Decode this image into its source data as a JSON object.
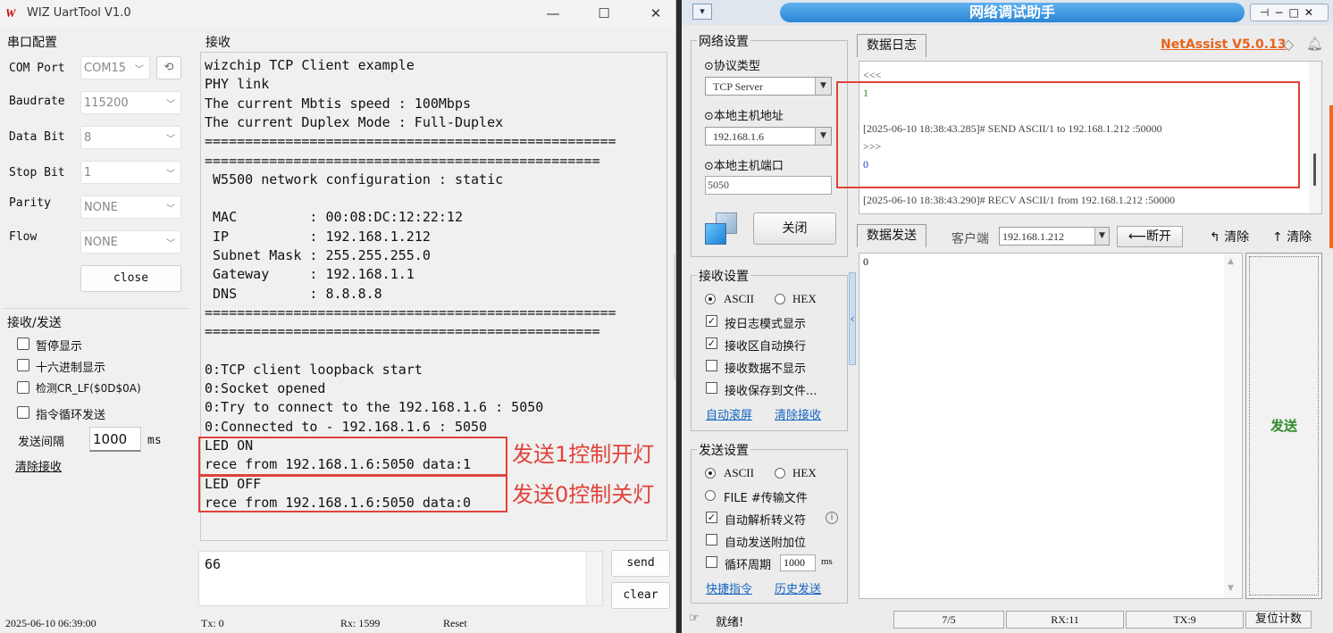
{
  "left": {
    "title": "WIZ UartTool V1.0",
    "minimize": "—",
    "maximize": "☐",
    "close": "✕",
    "serial_group": "串口配置",
    "com_port_label": "COM Port",
    "com_port_value": "COM15",
    "baudrate_label": "Baudrate",
    "baudrate_value": "115200",
    "databit_label": "Data Bit",
    "databit_value": "8",
    "stopbit_label": "Stop Bit",
    "stopbit_value": "1",
    "parity_label": "Parity",
    "parity_value": "NONE",
    "flow_label": "Flow",
    "flow_value": "NONE",
    "close_button": "close",
    "rxtx_group": "接收/发送",
    "pause_display": "暂停显示",
    "hex_display": "十六进制显示",
    "detect_crlf": "检测CR_LF($0D$0A)",
    "cycle_send": "指令循环发送",
    "send_interval_label": "发送间隔",
    "send_interval_value": "1000",
    "send_interval_unit": "ms",
    "clear_receive": "清除接收",
    "receive_group": "接收",
    "receive_lines": [
      "wizchip TCP Client example",
      "PHY link",
      "The current Mbtis speed : 100Mbps",
      "The current Duplex Mode : Full-Duplex",
      "===================================================",
      "=================================================",
      " W5500 network configuration : static",
      "",
      " MAC         : 00:08:DC:12:22:12",
      " IP          : 192.168.1.212",
      " Subnet Mask : 255.255.255.0",
      " Gateway     : 192.168.1.1",
      " DNS         : 8.8.8.8",
      "===================================================",
      "=================================================",
      "",
      "0:TCP client loopback start",
      "0:Socket opened",
      "0:Try to connect to the 192.168.1.6 : 5050",
      "0:Connected to - 192.168.1.6 : 5050",
      "LED ON",
      "rece from 192.168.1.6:5050 data:1",
      "LED OFF",
      "rece from 192.168.1.6:5050 data:0"
    ],
    "annotation_on": "发送1控制开灯",
    "annotation_off": "发送0控制关灯",
    "send_input_value": "66",
    "send_button": "send",
    "clear_button": "clear",
    "status_time": "2025-06-10 06:39:00",
    "status_tx": "Tx: 0",
    "status_rx": "Rx: 1599",
    "status_reset": "Reset"
  },
  "right": {
    "title": "网络调试助手",
    "net_settings": "网络设置",
    "protocol_label": "⊙协议类型",
    "protocol_value": "TCP Server",
    "local_ip_label": "⊙本地主机地址",
    "local_ip_value": "192.168.1.6",
    "local_port_label": "⊙本地主机端口",
    "local_port_value": "5050",
    "close_button": "关闭",
    "recv_settings": "接收设置",
    "recv_ascii": "ASCII",
    "recv_hex": "HEX",
    "log_mode": "按日志模式显示",
    "auto_wrap": "接收区自动换行",
    "no_display": "接收数据不显示",
    "save_file": "接收保存到文件...",
    "auto_scroll": "自动滚屏",
    "clear_recv": "清除接收",
    "send_settings": "发送设置",
    "send_ascii": "ASCII",
    "send_hex": "HEX",
    "file_send": "FILE #传输文件",
    "auto_escape": "自动解析转义符",
    "auto_append": "自动发送附加位",
    "cycle_label": "循环周期",
    "cycle_value": "1000",
    "cycle_unit": "ms",
    "shortcut": "快捷指令",
    "history": "历史发送",
    "log_tab": "数据日志",
    "version": "NetAssist V5.0.13",
    "log_lines": [
      "<<<",
      "1",
      "",
      "[2025-06-10 18:38:43.285]# SEND ASCII/1 to 192.168.1.212 :50000",
      ">>>",
      "0",
      "",
      "[2025-06-10 18:38:43.290]# RECV ASCII/1 from 192.168.1.212 :50000"
    ],
    "send_tab": "数据发送",
    "client_label": "客户端",
    "client_value": "192.168.1.212",
    "disconnect": "断开",
    "clear1": "清除",
    "clear2": "清除",
    "send_text": "0",
    "send_button": "发送",
    "status_ready": "就绪!",
    "status_count": "7/5",
    "status_rx": "RX:11",
    "status_tx": "TX:9",
    "reset_count": "复位计数"
  }
}
